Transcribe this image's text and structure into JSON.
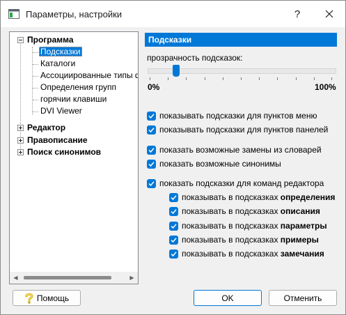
{
  "window": {
    "title": "Параметры, настройки",
    "help_glyph": "?",
    "close_glyph": "✕"
  },
  "tree": {
    "groups": [
      {
        "label": "Программа",
        "expanded": true,
        "children": [
          {
            "label": "Подсказки",
            "selected": true
          },
          {
            "label": "Каталоги"
          },
          {
            "label": "Ассоциированные типы ф"
          },
          {
            "label": "Определения групп"
          },
          {
            "label": "горячии клавиши"
          },
          {
            "label": "DVI Viewer"
          }
        ]
      },
      {
        "label": "Редактор",
        "expanded": false
      },
      {
        "label": "Правописание",
        "expanded": false
      },
      {
        "label": "Поиск синонимов",
        "expanded": false
      }
    ]
  },
  "panel": {
    "header": "Подсказки",
    "transparency_label": "прозрачность подсказок:",
    "transparency_min_label": "0%",
    "transparency_max_label": "100%",
    "transparency_value": 0.13
  },
  "options": {
    "menu_tips": {
      "label": "показывать подсказки для пунктов меню",
      "checked": true
    },
    "panel_tips": {
      "label": "показывать подсказки для пунктов панелей",
      "checked": true
    },
    "dict_replacements": {
      "label": "показать возможные замены из словарей",
      "checked": true
    },
    "synonyms": {
      "label": "показать возможные синонимы",
      "checked": true
    },
    "editor_commands": {
      "label": "показать подсказки для команд редактора",
      "checked": true
    },
    "sub_prefix": "показывать в подсказках",
    "sub_items": [
      {
        "bold": "определения",
        "checked": true
      },
      {
        "bold": "описания",
        "checked": true
      },
      {
        "bold": "параметры",
        "checked": true
      },
      {
        "bold": "примеры",
        "checked": true
      },
      {
        "bold": "замечания",
        "checked": true
      }
    ]
  },
  "buttons": {
    "help": "Помощь",
    "ok": "OK",
    "cancel": "Отменить"
  },
  "colors": {
    "accent": "#0078d7",
    "window_bg": "#f0f0f0"
  }
}
